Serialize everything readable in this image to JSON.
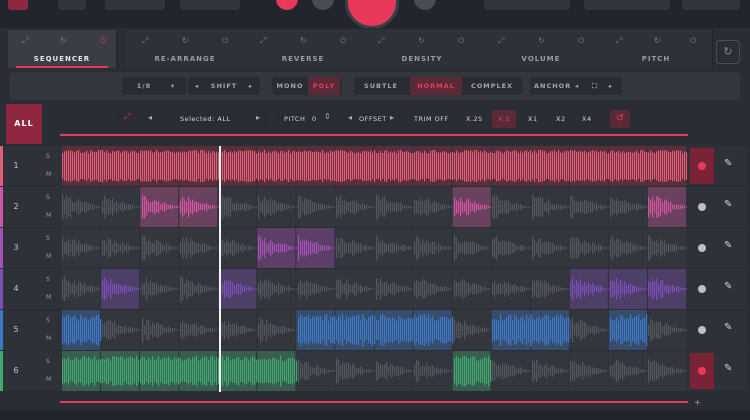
{
  "colors": {
    "accent": "#e8395a",
    "lane_colors": [
      "#e15c74",
      "#d2569f",
      "#a550b5",
      "#7b4fb6",
      "#3d78c6",
      "#40a870"
    ]
  },
  "tabs": [
    {
      "label": "SEQUENCER",
      "active": true
    },
    {
      "label": "RE-ARRANGE",
      "active": false
    },
    {
      "label": "REVERSE",
      "active": false
    },
    {
      "label": "DENSITY",
      "active": false
    },
    {
      "label": "VOLUME",
      "active": false
    },
    {
      "label": "PITCH",
      "active": false
    }
  ],
  "toolbar": {
    "rate": "1/8",
    "shift": "SHIFT",
    "mono": "MONO",
    "poly": "POLY",
    "subtle": "SUBTLE",
    "normal": "NORMAL",
    "complex": "COMPLEX",
    "anchor": "ANCHOR"
  },
  "seqhead": {
    "all": "ALL",
    "selected": "Selected: ALL",
    "pitch_label": "PITCH",
    "pitch_value": "0",
    "offset": "OFFSET",
    "trim_off": "TRIM OFF",
    "speeds": [
      "X.25",
      "X.5",
      "X1",
      "X2",
      "X4"
    ],
    "active_speed": "X.5"
  },
  "lanes": [
    {
      "num": "1",
      "s": "S",
      "m": "M",
      "armed": true
    },
    {
      "num": "2",
      "s": "S",
      "m": "M",
      "armed": false
    },
    {
      "num": "3",
      "s": "S",
      "m": "M",
      "armed": false
    },
    {
      "num": "4",
      "s": "S",
      "m": "M",
      "armed": false
    },
    {
      "num": "5",
      "s": "S",
      "m": "M",
      "armed": false
    },
    {
      "num": "6",
      "s": "S",
      "m": "M",
      "armed": true
    }
  ],
  "plus": "+"
}
